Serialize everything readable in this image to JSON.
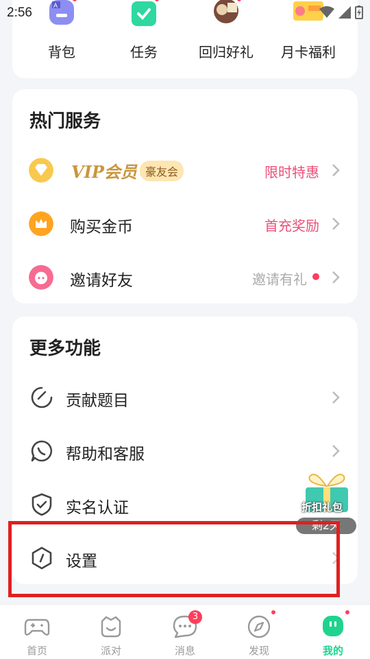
{
  "status_bar": {
    "time": "2:56"
  },
  "top_items": [
    {
      "label": "背包",
      "icon": "backpack-icon"
    },
    {
      "label": "任务",
      "icon": "task-icon"
    },
    {
      "label": "回归好礼",
      "icon": "return-gift-icon"
    },
    {
      "label": "月卡福利",
      "icon": "monthly-card-icon"
    }
  ],
  "hot_services": {
    "title": "热门服务",
    "vip": {
      "label": "VIP会员",
      "badge": "豪友会",
      "right": "限时特惠"
    },
    "coins": {
      "label": "购买金币",
      "right": "首充奖励"
    },
    "invite": {
      "label": "邀请好友",
      "right": "邀请有礼"
    }
  },
  "more_features": {
    "title": "更多功能",
    "items": [
      {
        "label": "贡献题目",
        "icon": "contribute-icon"
      },
      {
        "label": "帮助和客服",
        "icon": "help-chat-icon"
      },
      {
        "label": "实名认证",
        "icon": "shield-check-icon"
      },
      {
        "label": "设置",
        "icon": "settings-icon"
      }
    ]
  },
  "gift": {
    "text": "折扣礼包",
    "pill": "剩2天"
  },
  "tabs": [
    {
      "label": "首页",
      "icon": "gamepad-icon"
    },
    {
      "label": "派对",
      "icon": "party-icon"
    },
    {
      "label": "消息",
      "icon": "message-icon",
      "badge": "3"
    },
    {
      "label": "发现",
      "icon": "compass-icon"
    },
    {
      "label": "我的",
      "icon": "me-icon",
      "active": true
    }
  ],
  "colors": {
    "accent": "#1fd38f",
    "pink": "#ec4f79",
    "red_dot": "#ff3d5c",
    "highlight": "#e02020"
  }
}
